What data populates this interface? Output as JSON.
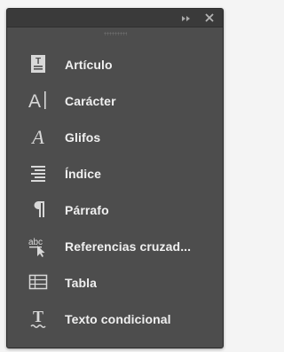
{
  "panel": {
    "items": [
      {
        "label": "Artículo",
        "icon": "article-icon"
      },
      {
        "label": "Carácter",
        "icon": "character-icon"
      },
      {
        "label": "Glifos",
        "icon": "glyphs-icon"
      },
      {
        "label": "Índice",
        "icon": "index-icon"
      },
      {
        "label": "Párrafo",
        "icon": "paragraph-icon"
      },
      {
        "label": "Referencias cruzad...",
        "icon": "cross-references-icon"
      },
      {
        "label": "Tabla",
        "icon": "table-icon"
      },
      {
        "label": "Texto condicional",
        "icon": "conditional-text-icon"
      }
    ],
    "close_glyph": "×"
  },
  "colors": {
    "panel_bg": "#4d4d4d",
    "titlebar_bg": "#3a3a3a",
    "text": "#f0f0f0",
    "icon": "#d8d8d8"
  }
}
